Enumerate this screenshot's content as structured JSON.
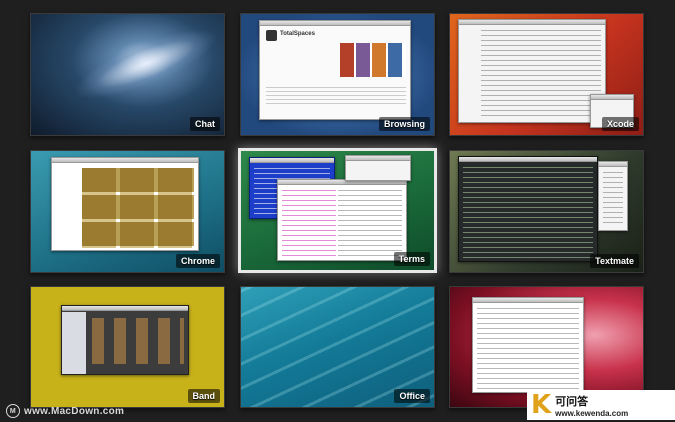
{
  "spaces": [
    {
      "id": "chat",
      "label": "Chat",
      "selected": false
    },
    {
      "id": "browsing",
      "label": "Browsing",
      "selected": false
    },
    {
      "id": "xcode",
      "label": "Xcode",
      "selected": false
    },
    {
      "id": "chrome",
      "label": "Chrome",
      "selected": false
    },
    {
      "id": "terms",
      "label": "Terms",
      "selected": true
    },
    {
      "id": "textmate",
      "label": "Textmate",
      "selected": false
    },
    {
      "id": "band",
      "label": "Band",
      "selected": false
    },
    {
      "id": "office",
      "label": "Office",
      "selected": false
    },
    {
      "id": "last",
      "label": "",
      "selected": false
    }
  ],
  "browsing_window": {
    "title": "TotalSpaces"
  },
  "watermark": {
    "left_text": "www.MacDown.com",
    "right_logo": "K",
    "right_cn": "可问答",
    "right_url": "www.kewenda.com"
  }
}
